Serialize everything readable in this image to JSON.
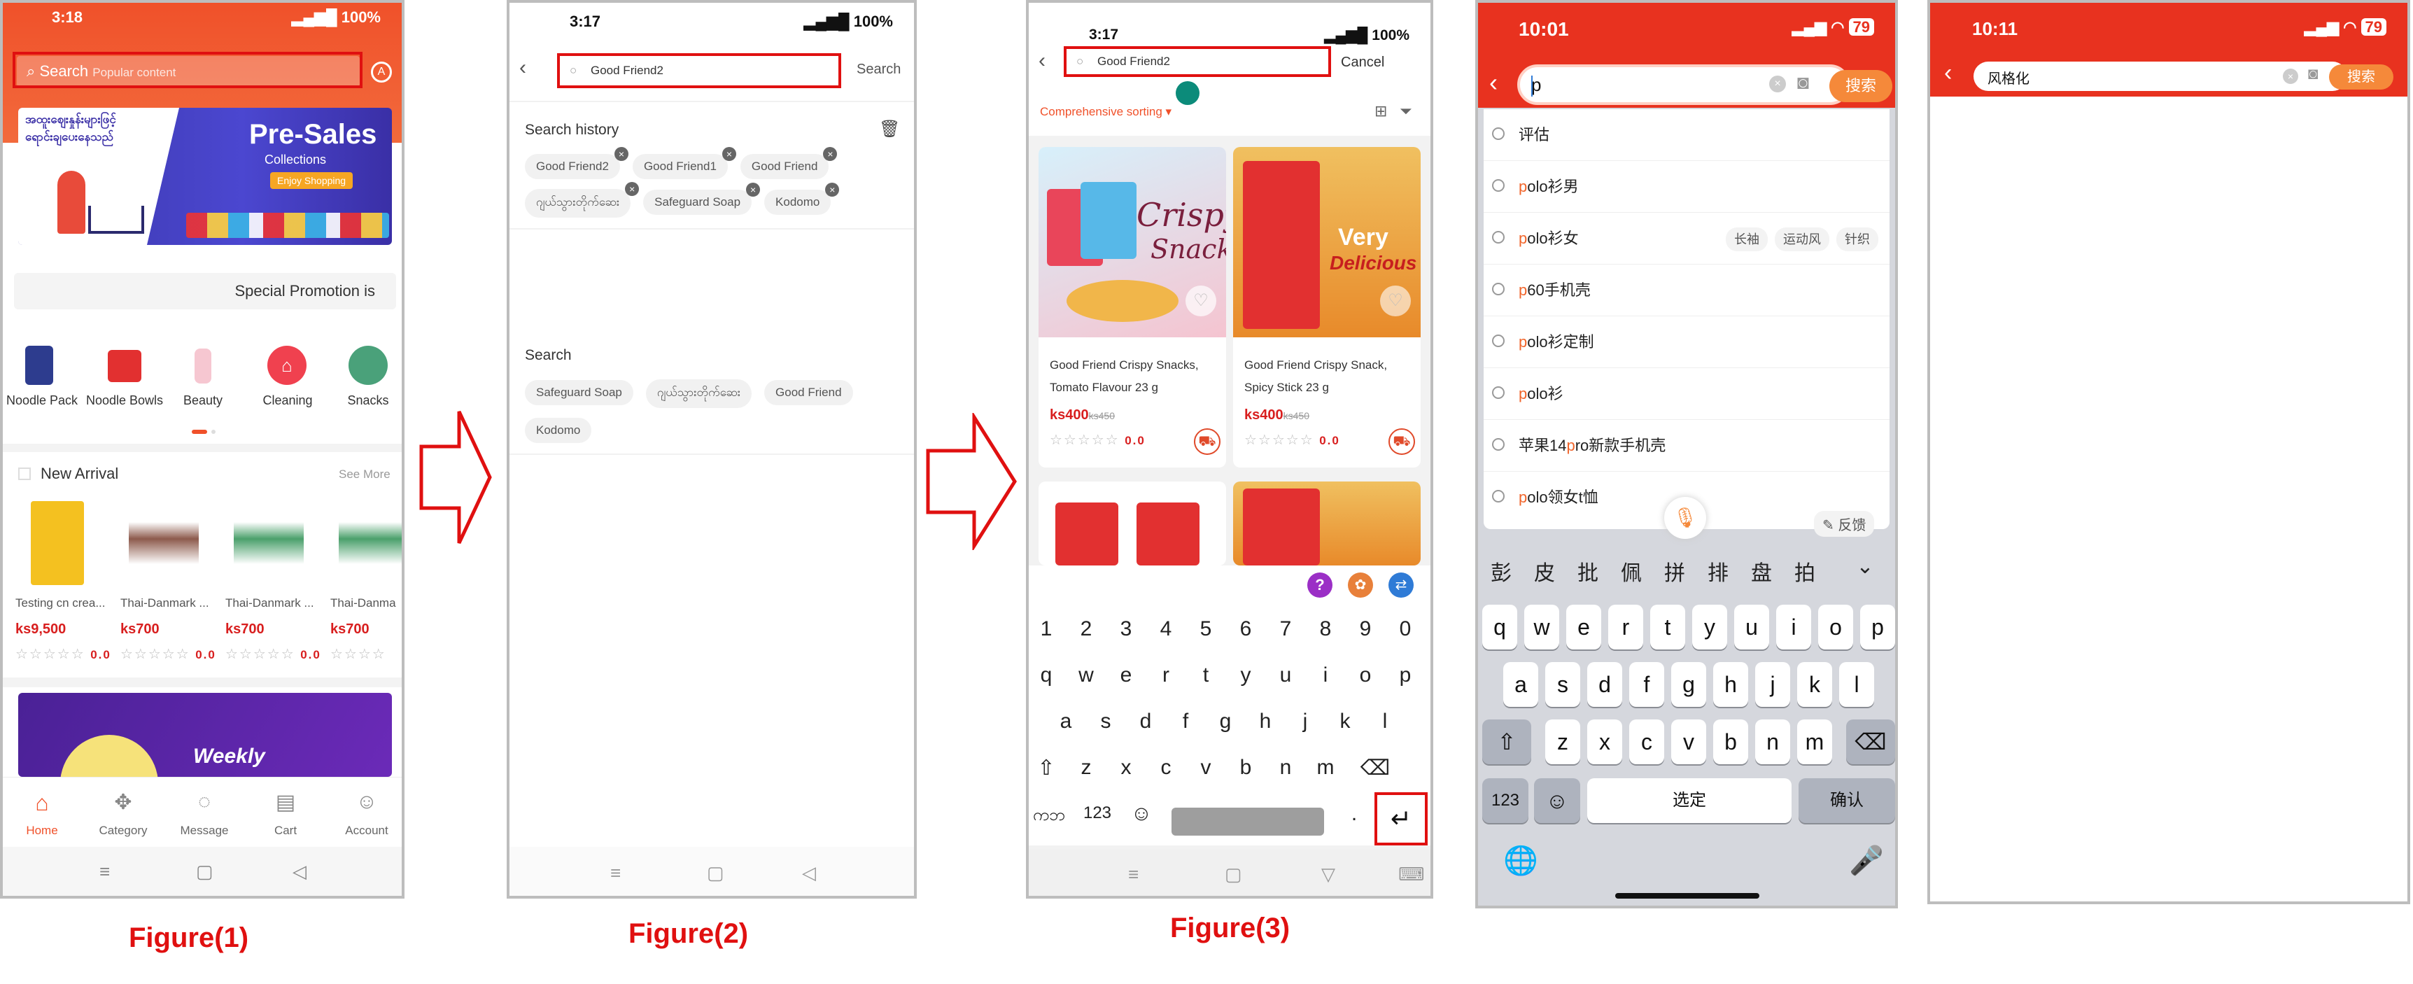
{
  "captions": {
    "fig1": "Figure(1)",
    "fig2": "Figure(2)",
    "fig3": "Figure(3)"
  },
  "p1": {
    "status": {
      "time": "3:18",
      "battery": "100%"
    },
    "search": {
      "label": "Search",
      "placeholder": "Popular content"
    },
    "banner": {
      "heading": "Pre-Sales",
      "sub": "Collections",
      "btn": "Enjoy Shopping",
      "burmese1": "အထူးစျေးနှုန်းများဖြင့်",
      "burmese2": "ရောင်းချပေးနေသည်"
    },
    "promo": "Special Promotion is",
    "categories": [
      "Noodle Pack",
      "Noodle Bowls",
      "Beauty",
      "Cleaning",
      "Snacks"
    ],
    "new_arrival": {
      "title": "New Arrival",
      "more": "See More",
      "items": [
        {
          "name": "Testing cn crea...",
          "price": "ks9,500",
          "rating": "0.0"
        },
        {
          "name": "Thai-Danmark ...",
          "price": "ks700",
          "rating": "0.0"
        },
        {
          "name": "Thai-Danmark ...",
          "price": "ks700",
          "rating": "0.0"
        },
        {
          "name": "Thai-Danma",
          "price": "ks700",
          "rating": ""
        }
      ]
    },
    "weekly": "Weekly",
    "tabs": [
      "Home",
      "Category",
      "Message",
      "Cart",
      "Account"
    ],
    "colors": {
      "accent": "#f0512a",
      "price": "#d81e1e"
    }
  },
  "p2": {
    "status": {
      "time": "3:17",
      "battery": "100%"
    },
    "search_value": "Good Friend2",
    "search_btn": "Search",
    "history_title": "Search history",
    "history": [
      "Good Friend2",
      "Good Friend1",
      "Good Friend",
      "ဂျယ်သွားတိုက်ဆေး",
      "Safeguard Soap",
      "Kodomo"
    ],
    "search_title": "Search",
    "suggest": [
      "Safeguard Soap",
      "ဂျယ်သွားတိုက်ဆေး",
      "Good Friend",
      "Kodomo"
    ]
  },
  "p3": {
    "status": {
      "time": "3:17",
      "battery": "100%"
    },
    "search_value": "Good Friend2",
    "cancel": "Cancel",
    "sort": "Comprehensive sorting",
    "products": [
      {
        "name1": "Good Friend Crispy Snacks,",
        "name2": "Tomato Flavour 23 g",
        "price": "ks400",
        "old": "ks450",
        "rating": "0.0",
        "img1": "Crispy",
        "img2": "Snack"
      },
      {
        "name1": "Good Friend Crispy Snack,",
        "name2": "Spicy Stick 23 g",
        "price": "ks400",
        "old": "ks450",
        "rating": "0.0",
        "img1": "Very",
        "img2": "Delicious"
      }
    ],
    "keys_num": [
      "1",
      "2",
      "3",
      "4",
      "5",
      "6",
      "7",
      "8",
      "9",
      "0"
    ],
    "keys_r1": [
      "q",
      "w",
      "e",
      "r",
      "t",
      "y",
      "u",
      "i",
      "o",
      "p"
    ],
    "keys_r2": [
      "a",
      "s",
      "d",
      "f",
      "g",
      "h",
      "j",
      "k",
      "l"
    ],
    "keys_r3": [
      "z",
      "x",
      "c",
      "v",
      "b",
      "n",
      "m"
    ],
    "lang": "ကဘ",
    "num": "123",
    "dot": "."
  },
  "p4": {
    "status": {
      "time": "10:01",
      "battery": "79"
    },
    "search_value": "p",
    "search_btn": "搜索",
    "suggestions": [
      {
        "pre": "",
        "hl": "",
        "txt": "评估",
        "tags": []
      },
      {
        "pre": "",
        "hl": "p",
        "txt": "olo衫男",
        "tags": []
      },
      {
        "pre": "",
        "hl": "p",
        "txt": "olo衫女",
        "tags": [
          "长袖",
          "运动风",
          "针织"
        ]
      },
      {
        "pre": "",
        "hl": "p",
        "txt": "60手机壳",
        "tags": []
      },
      {
        "pre": "",
        "hl": "p",
        "txt": "olo衫定制",
        "tags": []
      },
      {
        "pre": "",
        "hl": "p",
        "txt": "olo衫",
        "tags": []
      },
      {
        "pre": "苹果14",
        "hl": "p",
        "txt": "ro新款手机壳",
        "tags": []
      },
      {
        "pre": "",
        "hl": "p",
        "txt": "olo领女t恤",
        "tags": []
      }
    ],
    "feedback": "反馈",
    "candidates": [
      "彭",
      "皮",
      "批",
      "佩",
      "拼",
      "排",
      "盘",
      "拍"
    ],
    "r1": [
      "q",
      "w",
      "e",
      "r",
      "t",
      "y",
      "u",
      "i",
      "o",
      "p"
    ],
    "r2": [
      "a",
      "s",
      "d",
      "f",
      "g",
      "h",
      "j",
      "k",
      "l"
    ],
    "r3": [
      "z",
      "x",
      "c",
      "v",
      "b",
      "n",
      "m"
    ],
    "k123": "123",
    "space": "选定",
    "confirm": "确认"
  },
  "p5": {
    "status": {
      "time": "10:11",
      "battery": "79"
    },
    "search_value": "风格化",
    "search_btn": "搜索"
  }
}
